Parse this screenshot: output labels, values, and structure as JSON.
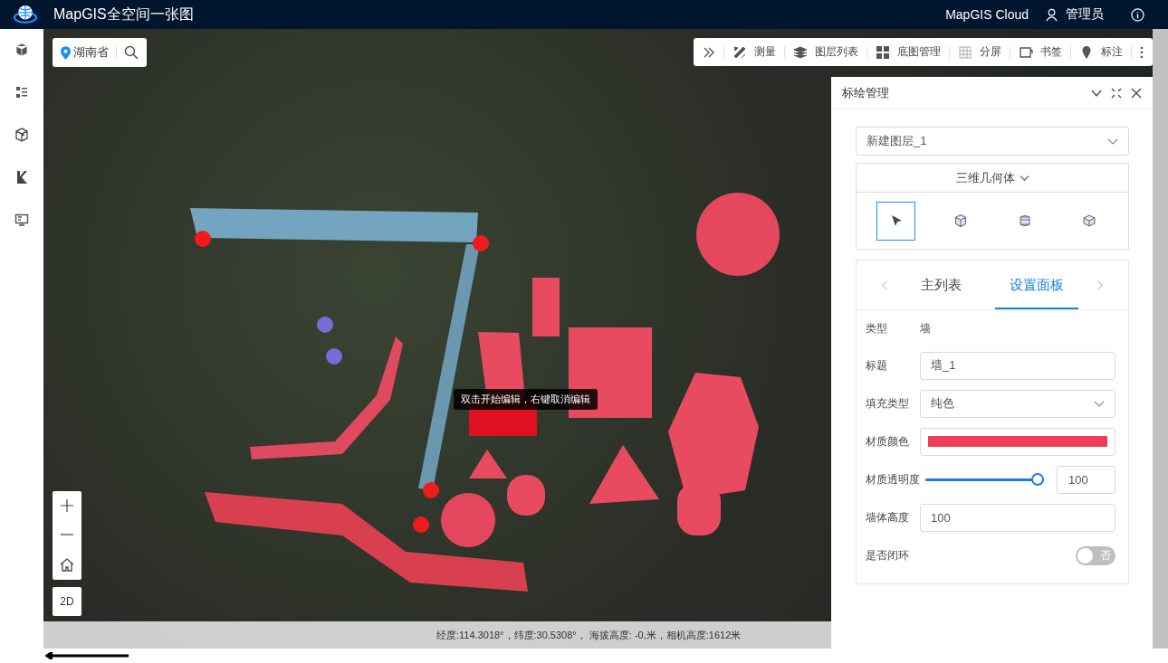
{
  "header": {
    "title": "MapGIS全空间一张图",
    "cloud": "MapGIS Cloud",
    "user": "管理员"
  },
  "sidebar": {
    "items": [
      {
        "kind": "cube"
      },
      {
        "kind": "list"
      },
      {
        "kind": "layers"
      },
      {
        "kind": "k"
      },
      {
        "kind": "screen"
      }
    ]
  },
  "search": {
    "location": "湖南省"
  },
  "toolbar": {
    "items": [
      {
        "kind": "measure",
        "label": "测量"
      },
      {
        "kind": "layers",
        "label": "图层列表"
      },
      {
        "kind": "grid",
        "label": "底图管理"
      },
      {
        "kind": "split",
        "label": "分屏"
      },
      {
        "kind": "bookmark",
        "label": "书签"
      },
      {
        "kind": "pin",
        "label": "标注"
      }
    ]
  },
  "map": {
    "tooltip": "双击开始编辑，右键取消编辑",
    "view_toggle": "2D"
  },
  "panel": {
    "title": "标绘管理",
    "layer_select": "新建图层_1",
    "category": "三维几何体",
    "tools": [
      {
        "kind": "pointer",
        "selected": true
      },
      {
        "kind": "cube",
        "selected": false
      },
      {
        "kind": "cylinder",
        "selected": false
      },
      {
        "kind": "box",
        "selected": false
      }
    ],
    "tabs": [
      {
        "label": "主列表",
        "selected": false
      },
      {
        "label": "设置面板",
        "selected": true
      }
    ],
    "fields": [
      {
        "kind": "text",
        "label": "类型",
        "value": "墙"
      },
      {
        "kind": "input",
        "label": "标题",
        "value": "墙_1"
      },
      {
        "kind": "select",
        "label": "填充类型",
        "value": "纯色"
      },
      {
        "kind": "color",
        "label": "材质颜色",
        "color": "#ef3f56"
      },
      {
        "kind": "slider",
        "label": "材质透明度",
        "level": 1,
        "value": "100"
      },
      {
        "kind": "input",
        "label": "墙体高度",
        "value": "100"
      },
      {
        "kind": "switch",
        "label": "是否闭环",
        "on": false,
        "off_label": "否"
      }
    ]
  },
  "status_bar": "经度:114.3018°，纬度:30.5308°， 海拔高度: -0,米，相机高度:1612米"
}
